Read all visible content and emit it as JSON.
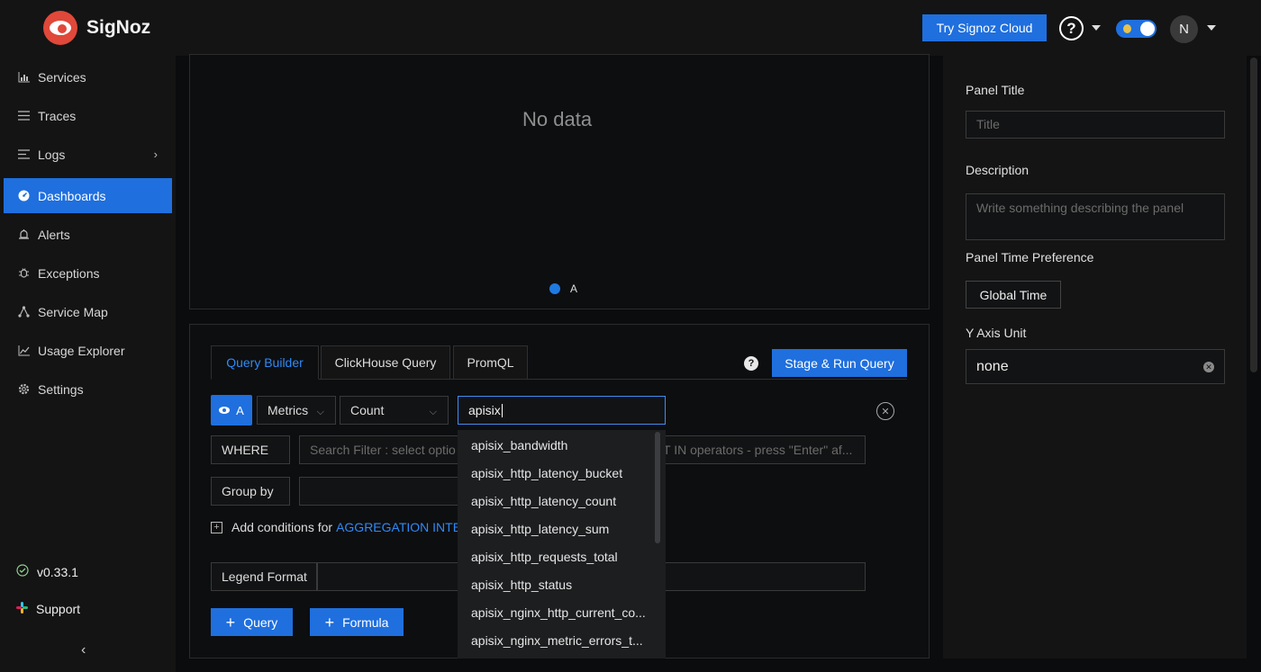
{
  "app": {
    "name": "SigNoz"
  },
  "header": {
    "cloud_button": "Try Signoz Cloud",
    "help_icon": "?",
    "avatar_initial": "N"
  },
  "sidebar": {
    "items": [
      {
        "label": "Services",
        "icon": "bar-chart-icon"
      },
      {
        "label": "Traces",
        "icon": "menu-icon"
      },
      {
        "label": "Logs",
        "icon": "list-icon"
      },
      {
        "label": "Dashboards",
        "icon": "dashboard-icon",
        "active": true
      },
      {
        "label": "Alerts",
        "icon": "bell-icon"
      },
      {
        "label": "Exceptions",
        "icon": "bug-icon"
      },
      {
        "label": "Service Map",
        "icon": "network-icon"
      },
      {
        "label": "Usage Explorer",
        "icon": "line-chart-icon"
      },
      {
        "label": "Settings",
        "icon": "gear-icon"
      }
    ],
    "version": "v0.33.1",
    "support": "Support"
  },
  "chart_panel": {
    "empty_text": "No data",
    "legend_label": "A",
    "legend_color": "#1f7ae0"
  },
  "query": {
    "tabs": [
      "Query Builder",
      "ClickHouse Query",
      "PromQL"
    ],
    "active_tab": "Query Builder",
    "help_icon": "?",
    "run_button": "Stage & Run Query",
    "query_label": "A",
    "data_source": "Metrics",
    "aggregate": "Count",
    "metric_search_value": "apisix",
    "where_label": "WHERE",
    "where_placeholder": "Search Filter : select optio",
    "where_placeholder_tail": "T IN operators - press \"Enter\" af...",
    "group_by_label": "Group by",
    "add_conditions_text": "Add conditions for",
    "add_conditions_link": "AGGREGATION INTE",
    "legend_format_label": "Legend Format",
    "add_query_button": "Query",
    "add_formula_button": "Formula",
    "metric_options": [
      "apisix_bandwidth",
      "apisix_http_latency_bucket",
      "apisix_http_latency_count",
      "apisix_http_latency_sum",
      "apisix_http_requests_total",
      "apisix_http_status",
      "apisix_nginx_http_current_co...",
      "apisix_nginx_metric_errors_t..."
    ]
  },
  "panel_attributes": {
    "panel_title_label": "Panel Title",
    "panel_title_placeholder": "Title",
    "description_label": "Description",
    "description_placeholder": "Write something describing the  panel",
    "time_pref_label": "Panel Time Preference",
    "time_pref_value": "Global Time",
    "y_axis_label": "Y Axis Unit",
    "y_axis_value": "none"
  },
  "colors": {
    "accent": "#1f6fde",
    "link": "#2f8af5",
    "background": "#0b0c0e"
  }
}
